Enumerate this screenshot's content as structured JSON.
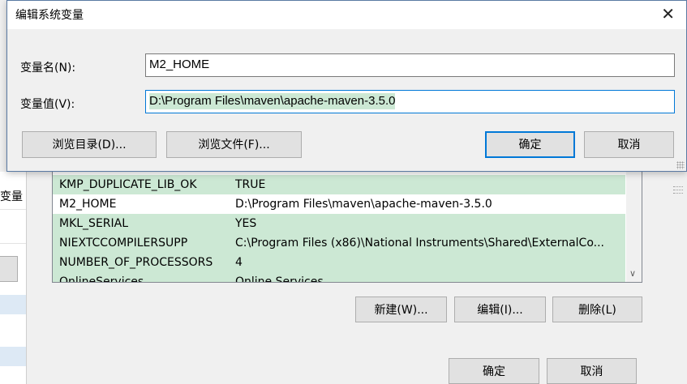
{
  "edit_dialog": {
    "title": "编辑系统变量",
    "name_label": "变量名(N):",
    "name_value": "M2_HOME",
    "value_label": "变量值(V):",
    "value_value": "D:\\Program Files\\maven\\apache-maven-3.5.0",
    "browse_dir_label": "浏览目录(D)...",
    "browse_file_label": "浏览文件(F)...",
    "ok_label": "确定",
    "cancel_label": "取消"
  },
  "env_dialog": {
    "variables": [
      {
        "name": "KMP_DUPLICATE_LIB_OK",
        "value": "TRUE"
      },
      {
        "name": "M2_HOME",
        "value": "D:\\Program Files\\maven\\apache-maven-3.5.0"
      },
      {
        "name": "MKL_SERIAL",
        "value": "YES"
      },
      {
        "name": "NIEXTCCOMPILERSUPP",
        "value": "C:\\Program Files (x86)\\National Instruments\\Shared\\ExternalCo..."
      },
      {
        "name": "NUMBER_OF_PROCESSORS",
        "value": "4"
      },
      {
        "name": "OnlineServices",
        "value": "Online Services"
      }
    ],
    "new_label": "新建(W)...",
    "edit_label": "编辑(I)...",
    "delete_label": "删除(L)",
    "ok_label": "确定",
    "cancel_label": "取消"
  },
  "outer_window": {
    "partial_label": "变量"
  },
  "colors": {
    "selection": "#cce8d4",
    "focus_border": "#0078d7",
    "button_face": "#e1e1e1"
  }
}
